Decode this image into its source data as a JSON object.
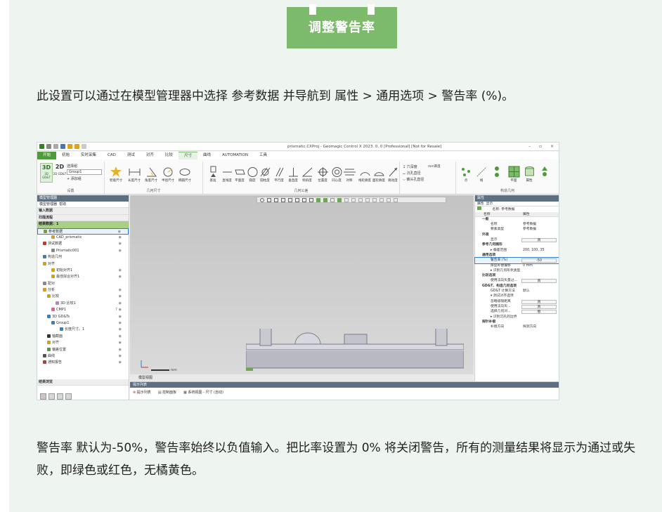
{
  "badge": "调整警告率",
  "intro": "此设置可以通过在模型管理器中选择 参考数据 并导航到 属性 > 通用选项 > 警告率 (%)。",
  "footer": "警告率 默认为-50%，警告率始终以负值输入。把比率设置为 0% 将关闭警告，所有的测量结果将显示为通过或失败，即绿色或红色，无橘黄色。",
  "app": {
    "window_title": "prismatic.CXProj - Geomagic Control X 2023. 0. 0 [Professional] [Not for Resale]",
    "window_controls": "– ▫ ×",
    "tabs": [
      "开始",
      "初始",
      "实时采集",
      "CAD",
      "测试",
      "对齐",
      "比较",
      "尺寸",
      "曲线",
      "AUTOMATION",
      "工具"
    ],
    "active_tab": "尺寸",
    "ribbon": {
      "g1": {
        "label": "设置",
        "b3d": "3D",
        "b2d": "2D",
        "sub3d": "3D GD&T",
        "sub2d": "2D GD&T",
        "select_label": "选择组",
        "select_value": "Group1",
        "add": "添加组"
      },
      "g2": {
        "label": "几何尺寸",
        "tools": [
          "智能尺寸",
          "长度尺寸",
          "角度尺寸",
          "半径尺寸",
          "椭圆尺寸"
        ]
      },
      "g3": {
        "label": "几何公差",
        "tools": [
          "基准",
          "直线度",
          "平面度",
          "圆度",
          "圆柱度",
          "平行度",
          "垂直度",
          "倾斜度",
          "位置度",
          "同心度",
          "对称",
          "线轮廓度",
          "面轮廓度",
          "跳动度"
        ]
      },
      "g4": {
        "items": [
          "穴深度",
          "沉孔直径",
          "锥头孔直径"
        ],
        "extra": "mm厚度"
      },
      "g5": {
        "label": "构造几何",
        "tools": [
          "点",
          "线",
          "平面",
          "属性"
        ]
      }
    },
    "model_manager": {
      "title": "模型管理器",
      "subtabs": [
        "模型管理器",
        "帮助"
      ],
      "sections": [
        "输入数据",
        "扫描流程",
        "结果数据：1"
      ],
      "tree": [
        {
          "label": "参考数据",
          "indent": 1,
          "icon": "#7a9c3a",
          "eye": "◉"
        },
        {
          "label": "CAD_prismatic",
          "indent": 3,
          "icon": "#c9a227",
          "eye": "◉"
        },
        {
          "label": "测试数据",
          "indent": 1,
          "icon": "#c0392b",
          "eye": "◉"
        },
        {
          "label": "Prismatic001",
          "indent": 3,
          "icon": "#888888",
          "eye": "◉"
        },
        {
          "label": "构造几何",
          "indent": 1,
          "icon": "#3d7fb8",
          "eye": ""
        },
        {
          "label": "对齐",
          "indent": 1,
          "icon": "#d4a017",
          "eye": ""
        },
        {
          "label": "初始对齐1",
          "indent": 3,
          "icon": "#d4a017",
          "eye": "◉"
        },
        {
          "label": "最佳拟合对齐1",
          "indent": 3,
          "icon": "#d4a017",
          "eye": "◉"
        },
        {
          "label": "配对",
          "indent": 1,
          "icon": "#888888",
          "eye": ""
        },
        {
          "label": "分析",
          "indent": 1,
          "icon": "#d4a017",
          "eye": "◉"
        },
        {
          "label": "比较",
          "indent": 2,
          "icon": "#d4a017",
          "eye": "◉"
        },
        {
          "label": "3D 比较1",
          "indent": 4,
          "icon": "#b388c8",
          "eye": "◉"
        },
        {
          "label": "CMP1",
          "indent": 3,
          "icon": "#d46a8c",
          "eye": "7 ◉"
        },
        {
          "label": "3D GD&Ts",
          "indent": 2,
          "icon": "#3d7fb8",
          "eye": "◉"
        },
        {
          "label": "Group1",
          "indent": 3,
          "icon": "#3d7fb8",
          "eye": "◉"
        },
        {
          "label": "长度尺寸。1",
          "indent": 5,
          "icon": "#3d7fb8",
          "eye": "◉"
        },
        {
          "label": "轴截面",
          "indent": 2,
          "icon": "#333333",
          "eye": "◉"
        },
        {
          "label": "对齐",
          "indent": 2,
          "icon": "#d4a017",
          "eye": "◉"
        },
        {
          "label": "偏差位置",
          "indent": 2,
          "icon": "#4f9b3c",
          "eye": "◉"
        },
        {
          "label": "曲线",
          "indent": 1,
          "icon": "#555555",
          "eye": "◉"
        },
        {
          "label": "通知报告",
          "indent": 1,
          "icon": "#c0392b",
          "eye": "◉"
        }
      ],
      "footer_label": "结果浏览"
    },
    "viewport": {
      "tab": "模型视图",
      "scale": "mm"
    },
    "bottom_panel": {
      "title": "提示列表",
      "tabs": [
        "提示列表",
        "控制面板",
        "系统视图 - 尺寸 (自动)"
      ]
    },
    "properties": {
      "title": "属性",
      "tabs": [
        "属性",
        "显示"
      ],
      "name_label": "名称: 参考数据",
      "col_name": "名称",
      "col_value": "属性",
      "rows": [
        {
          "cat": "一般"
        },
        {
          "k": "名称",
          "v": "参考数据"
        },
        {
          "k": "要素类型",
          "v": "参考数据"
        },
        {
          "cat": "外观"
        },
        {
          "k": "显示",
          "box": "真"
        },
        {
          "cat": "参考几何图形"
        },
        {
          "k": "▸ 偏差范围",
          "v": "200, 100, 35"
        },
        {
          "cat": "通用选项"
        },
        {
          "k": "警告率 (%)",
          "box": "-50",
          "hl": true
        },
        {
          "k": "厚度补偿偏移",
          "v": "0 mm"
        },
        {
          "k": "▸ 识别几何形状类型",
          "v": ""
        },
        {
          "cat": "比较选项"
        },
        {
          "k": "使用法向矢量过...",
          "box": "真"
        },
        {
          "cat": "GD&T、构造几何选项"
        },
        {
          "k": "GD&T 计算方法",
          "v": "默认"
        },
        {
          "k": "▾ 测试对齐选项",
          "v": ""
        },
        {
          "k": "忽略极限距离",
          "box": "真"
        },
        {
          "k": "使用法向矢...",
          "box": "真"
        },
        {
          "k": "选择几何对...",
          "box": "假"
        },
        {
          "k": "▸ 识别沉孔的边界",
          "v": ""
        },
        {
          "cat": "探针补偿"
        },
        {
          "k": "补偿方向",
          "v": "探测方向"
        }
      ]
    }
  }
}
